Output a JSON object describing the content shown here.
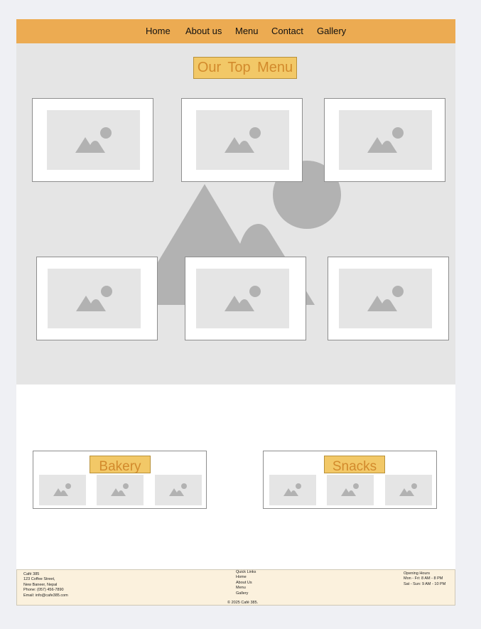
{
  "nav": {
    "items": [
      {
        "label": "Home"
      },
      {
        "label": "About us"
      },
      {
        "label": "Menu"
      },
      {
        "label": "Contact"
      },
      {
        "label": "Gallery"
      }
    ]
  },
  "hero": {
    "title": "Our  Top  Menu",
    "background_icon": "image-placeholder-icon",
    "cards": [
      {
        "image": "image-placeholder-icon"
      },
      {
        "image": "image-placeholder-icon"
      },
      {
        "image": "image-placeholder-icon"
      },
      {
        "image": "image-placeholder-icon"
      },
      {
        "image": "image-placeholder-icon"
      },
      {
        "image": "image-placeholder-icon"
      }
    ]
  },
  "categories": [
    {
      "title": "Bakery",
      "thumbs": 3
    },
    {
      "title": "Snacks",
      "thumbs": 3
    }
  ],
  "footer": {
    "contact": {
      "name": "Café 385",
      "street": "123 Coffee Street,",
      "city": "New Baneer, Nepal",
      "phone": "Phone: (057) 456-7890",
      "email": "Email: info@cafe385.com"
    },
    "links": {
      "heading": "Quick Links",
      "items": [
        "Home",
        "About Us",
        "Menu",
        "Gallery"
      ]
    },
    "hours": {
      "heading": "Opening Hours",
      "weekday": "Mon - Fri: 8 AM - 8 PM",
      "weekend": "Sat - Sun: 9 AM - 10 PM"
    },
    "copyright": "© 2025 Café 385."
  },
  "colors": {
    "nav_bg": "#ecab52",
    "title_bg": "#f2c867",
    "title_text": "#d28a2c",
    "placeholder_bg": "#e5e5e5",
    "placeholder_icon": "#b2b2b2",
    "footer_bg": "#fbf1dd"
  }
}
